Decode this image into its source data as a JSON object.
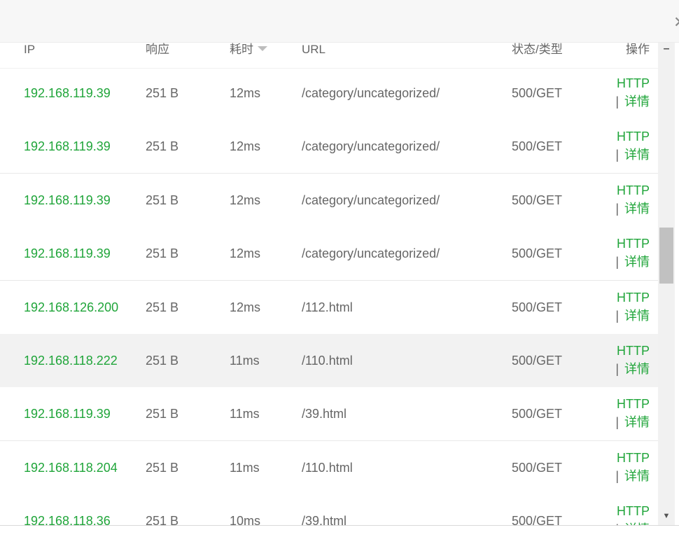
{
  "columns": {
    "ip": "IP",
    "response": "响应",
    "time": "耗时",
    "url": "URL",
    "status": "状态/类型",
    "actions": "操作"
  },
  "actions": {
    "http": "HTTP",
    "separator": "|",
    "details": "详情"
  },
  "rows": [
    {
      "ip": "192.168.119.39",
      "response": "251 B",
      "time": "12ms",
      "url": "/category/uncategorized/",
      "status": "500/GET"
    },
    {
      "ip": "192.168.119.39",
      "response": "251 B",
      "time": "12ms",
      "url": "/category/uncategorized/",
      "status": "500/GET"
    },
    {
      "ip": "192.168.119.39",
      "response": "251 B",
      "time": "12ms",
      "url": "/category/uncategorized/",
      "status": "500/GET"
    },
    {
      "ip": "192.168.119.39",
      "response": "251 B",
      "time": "12ms",
      "url": "/category/uncategorized/",
      "status": "500/GET"
    },
    {
      "ip": "192.168.126.200",
      "response": "251 B",
      "time": "12ms",
      "url": "/112.html",
      "status": "500/GET"
    },
    {
      "ip": "192.168.118.222",
      "response": "251 B",
      "time": "11ms",
      "url": "/110.html",
      "status": "500/GET"
    },
    {
      "ip": "192.168.119.39",
      "response": "251 B",
      "time": "11ms",
      "url": "/39.html",
      "status": "500/GET"
    },
    {
      "ip": "192.168.118.204",
      "response": "251 B",
      "time": "11ms",
      "url": "/110.html",
      "status": "500/GET"
    },
    {
      "ip": "192.168.118.36",
      "response": "251 B",
      "time": "10ms",
      "url": "/39.html",
      "status": "500/GET"
    }
  ],
  "highlighted_row": 5,
  "sorted_column": "time",
  "sort_direction": "descending",
  "colors": {
    "ip_text": "#20a53a",
    "action_link": "#20a53a",
    "text": "#666666",
    "row_border": "#e8e8e8",
    "highlight_row": "#f2f2f2"
  },
  "icons": {
    "sort": "caret-down-icon",
    "close": "close-icon",
    "scroll_up": "scroll-up-icon",
    "scroll_down": "scroll-down-icon"
  }
}
